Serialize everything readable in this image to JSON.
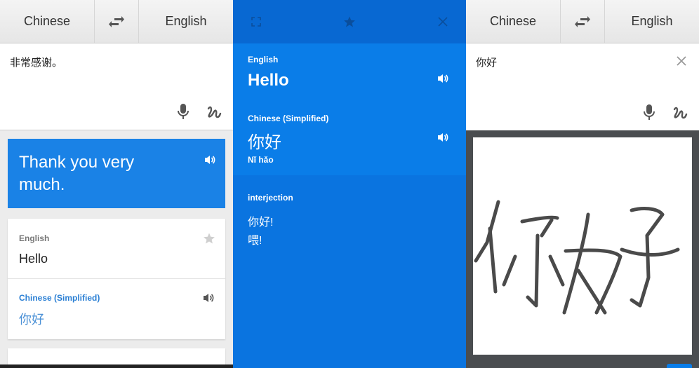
{
  "panel1": {
    "source_lang": "Chinese",
    "target_lang": "English",
    "input_text": "非常感谢。",
    "translation": "Thank you very much.",
    "phrasebook_card": {
      "src_label": "English",
      "src_text": "Hello",
      "dst_label": "Chinese (Simplified)",
      "dst_text": "你好"
    }
  },
  "panel2": {
    "src_label": "English",
    "src_text": "Hello",
    "dst_label": "Chinese (Simplified)",
    "dst_text": "你好",
    "romanization": "Nǐ hǎo",
    "pos": "interjection",
    "alternatives": [
      "你好!",
      "喂!"
    ]
  },
  "panel3": {
    "source_lang": "Chinese",
    "target_lang": "English",
    "input_text": "你好"
  },
  "colors": {
    "accent": "#0a7de8",
    "accent_dark": "#0868d2",
    "result_blue": "#1a82e6",
    "link_blue": "#2a7fd4"
  },
  "icons": [
    "swap-icon",
    "microphone-icon",
    "handwriting-icon",
    "speaker-icon",
    "star-icon",
    "fullscreen-icon",
    "close-icon"
  ]
}
